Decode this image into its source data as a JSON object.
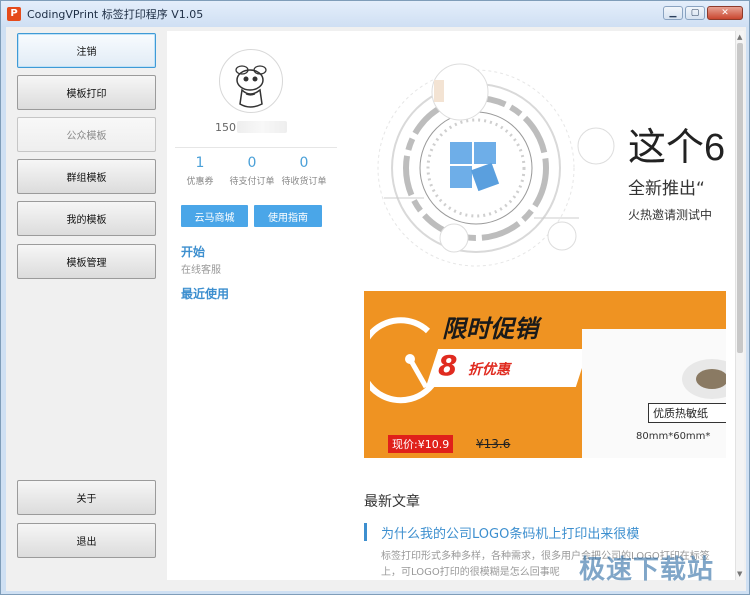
{
  "window": {
    "title": "CodingVPrint 标签打印程序 V1.05",
    "app_icon": "printer-logo-icon",
    "controls": [
      "minimize",
      "maximize",
      "close"
    ]
  },
  "sidebar": {
    "items": [
      {
        "label": "注销",
        "state": "active"
      },
      {
        "label": "模板打印",
        "state": "normal"
      },
      {
        "label": "公众模板",
        "state": "disabled"
      },
      {
        "label": "群组模板",
        "state": "normal"
      },
      {
        "label": "我的模板",
        "state": "normal"
      },
      {
        "label": "模板管理",
        "state": "normal"
      }
    ],
    "bottom_items": [
      {
        "label": "关于"
      },
      {
        "label": "退出"
      }
    ]
  },
  "user": {
    "avatar_icon": "cartoon-sheep-avatar-icon",
    "phone_prefix": "150",
    "stats": [
      {
        "value": "1",
        "label": "优惠券"
      },
      {
        "value": "0",
        "label": "待支付订单"
      },
      {
        "value": "0",
        "label": "待收货订单"
      }
    ],
    "buttons": {
      "store": "云马商城",
      "guide": "使用指南"
    },
    "start": {
      "title": "开始",
      "sub": "在线客服"
    },
    "recent": "最近使用"
  },
  "hero": {
    "big": "这个6",
    "line1": "全新推出“",
    "line2": "火热邀请测试中"
  },
  "promo": {
    "title": "限时促销",
    "discount_num": "8",
    "discount_text": "折优惠",
    "product_label": "优质热敏纸",
    "size": "80mm*60mm*",
    "price_now": "现价:¥10.9",
    "price_old": "¥13.6",
    "accent": "#ef9322"
  },
  "news": {
    "heading": "最新文章",
    "items": [
      {
        "title": "为什么我的公司LOGO条码机上打印出来很模",
        "body": "标签打印形式多种多样，各种需求，很多用户会把公司的LOGO打印在标签上，可LOGO打印的很模糊是怎么回事呢"
      }
    ]
  },
  "watermark": "极速下载站",
  "colors": {
    "link_blue": "#3d8fcf",
    "button_blue": "#4aa6e8",
    "price_red": "#e0201a"
  }
}
